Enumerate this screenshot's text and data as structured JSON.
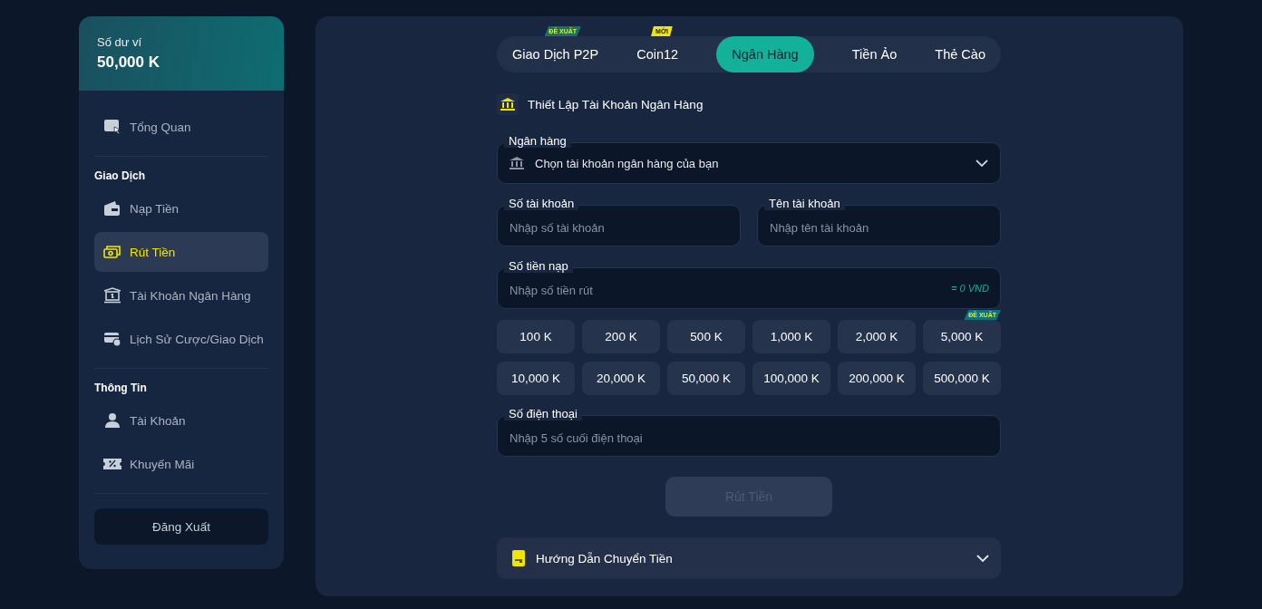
{
  "wallet": {
    "label": "Số dư ví",
    "amount": "50,000 K"
  },
  "sidebar": {
    "sections": [
      {
        "items": [
          {
            "label": "Tổng Quan",
            "selected": false
          }
        ]
      },
      {
        "title": "Giao Dịch",
        "items": [
          {
            "label": "Nạp Tiền",
            "selected": false
          },
          {
            "label": "Rút Tiền",
            "selected": true
          },
          {
            "label": "Tài Khoản Ngân Hàng",
            "selected": false
          },
          {
            "label": "Lịch Sử Cược/Giao Dịch",
            "selected": false
          }
        ]
      },
      {
        "title": "Thông Tin",
        "items": [
          {
            "label": "Tài Khoản",
            "selected": false
          },
          {
            "label": "Khuyến Mãi",
            "selected": false
          }
        ]
      }
    ],
    "logout": "Đăng Xuất"
  },
  "tabs": [
    {
      "label": "Giao Dịch P2P",
      "selected": false,
      "badge": {
        "text": "ĐỀ XUẤT",
        "color": "#12707a"
      }
    },
    {
      "label": "Coin12",
      "selected": false,
      "badge": {
        "text": "MỚI",
        "color": "#f2e600"
      }
    },
    {
      "label": "Ngân Hàng",
      "selected": true
    },
    {
      "label": "Tiền Ảo",
      "selected": false
    },
    {
      "label": "Thẻ Cào",
      "selected": false
    }
  ],
  "form": {
    "heading": "Thiết Lập Tài Khoản Ngân Hàng",
    "bank": {
      "label": "Ngân hàng",
      "placeholder": "Chọn tài khoản ngân hàng của bạn"
    },
    "account_number": {
      "label": "Số tài khoản",
      "placeholder": "Nhập số tài khoản"
    },
    "account_name": {
      "label": "Tên tài khoản",
      "placeholder": "Nhập tên tài khoản"
    },
    "amount": {
      "label": "Số tiền nạp",
      "placeholder": "Nhập số tiền rút",
      "conversion": "= 0 VND"
    },
    "presets": [
      {
        "label": "100 K"
      },
      {
        "label": "200 K"
      },
      {
        "label": "500 K"
      },
      {
        "label": "1,000 K"
      },
      {
        "label": "2,000 K"
      },
      {
        "label": "5,000 K",
        "badge": {
          "text": "ĐỀ XUẤT",
          "color": "#12707a"
        }
      },
      {
        "label": "10,000 K"
      },
      {
        "label": "20,000 K"
      },
      {
        "label": "50,000 K"
      },
      {
        "label": "100,000 K"
      },
      {
        "label": "200,000 K"
      },
      {
        "label": "500,000 K"
      }
    ],
    "phone": {
      "label": "Số điện thoại",
      "placeholder": "Nhập 5 số cuối điện thoại"
    },
    "submit": {
      "label": "Rút Tiền",
      "disabled": true
    },
    "guide": {
      "label": "Hướng Dẫn Chuyển Tiền",
      "expanded": false
    }
  }
}
